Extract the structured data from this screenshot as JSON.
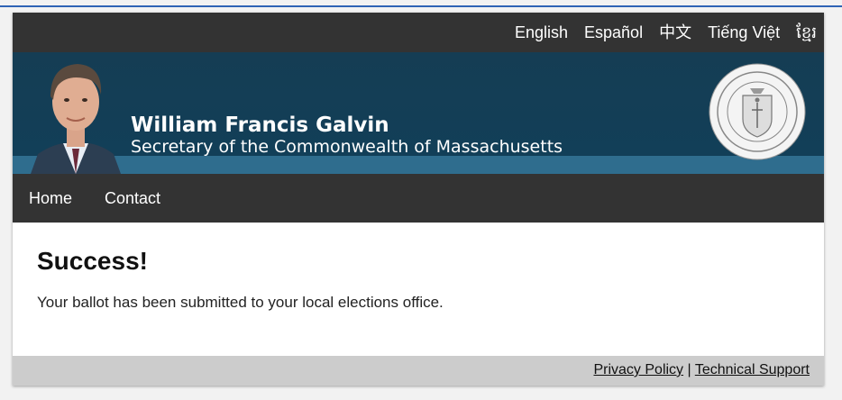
{
  "languages": [
    "English",
    "Español",
    "中文",
    "Tiếng Việt",
    "ខ្មែរ"
  ],
  "banner": {
    "name": "William Francis Galvin",
    "title": "Secretary of the Commonwealth of Massachusetts"
  },
  "nav": {
    "home": "Home",
    "contact": "Contact"
  },
  "main": {
    "heading": "Success!",
    "message": "Your ballot has been submitted to your local elections office."
  },
  "footer": {
    "privacy": "Privacy Policy",
    "separator": "|",
    "support": "Technical Support"
  }
}
